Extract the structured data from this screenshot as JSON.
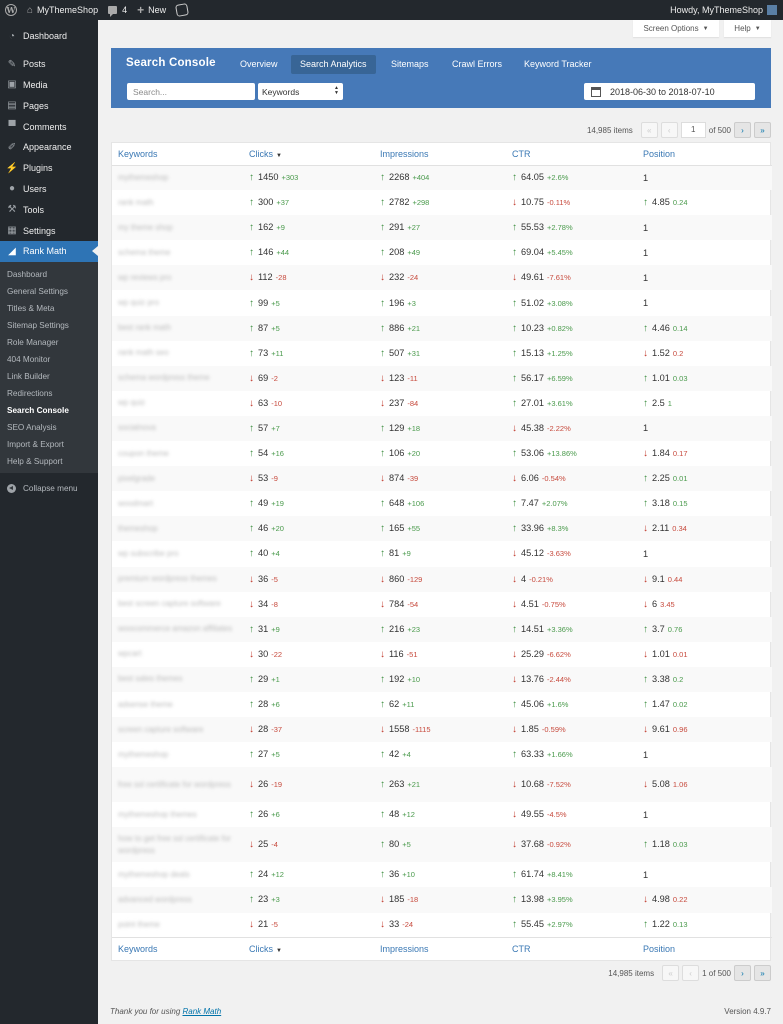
{
  "adminbar": {
    "site_name": "MyThemeShop",
    "comments_count": "4",
    "new_label": "New",
    "howdy": "Howdy, MyThemeShop"
  },
  "sidebar": {
    "items": [
      {
        "label": "Dashboard",
        "icon": "dashboard-icon"
      },
      {
        "label": "Posts",
        "icon": "pin-icon"
      },
      {
        "label": "Media",
        "icon": "media-icon"
      },
      {
        "label": "Pages",
        "icon": "pages-icon"
      },
      {
        "label": "Comments",
        "icon": "comment-icon"
      },
      {
        "label": "Appearance",
        "icon": "brush-icon"
      },
      {
        "label": "Plugins",
        "icon": "plugin-icon"
      },
      {
        "label": "Users",
        "icon": "user-icon"
      },
      {
        "label": "Tools",
        "icon": "wrench-icon"
      },
      {
        "label": "Settings",
        "icon": "settings-icon"
      },
      {
        "label": "Rank Math",
        "icon": "chart-icon"
      }
    ],
    "submenu": [
      "Dashboard",
      "General Settings",
      "Titles & Meta",
      "Sitemap Settings",
      "Role Manager",
      "404 Monitor",
      "Link Builder",
      "Redirections",
      "Search Console",
      "SEO Analysis",
      "Import & Export",
      "Help & Support"
    ],
    "current_submenu": "Search Console",
    "collapse_label": "Collapse menu"
  },
  "screen_meta": {
    "screen_options": "Screen Options",
    "help": "Help"
  },
  "header": {
    "title": "Search Console",
    "tabs": [
      "Overview",
      "Search Analytics",
      "Sitemaps",
      "Crawl Errors",
      "Keyword Tracker"
    ],
    "active_tab": "Search Analytics",
    "search_placeholder": "Search...",
    "dimension_select": "Keywords",
    "date_range": "2018-06-30 to 2018-07-10"
  },
  "pagination": {
    "items": "14,985 items",
    "current_page": "1",
    "of_pages": "of 500",
    "bottom_label": "1 of 500",
    "first": "«",
    "prev": "‹",
    "next": "›",
    "last": "»"
  },
  "table": {
    "columns": [
      "Keywords",
      "Clicks",
      "Impressions",
      "CTR",
      "Position"
    ],
    "sorted_column": "Clicks",
    "rows": [
      {
        "kw": "mythemeshop",
        "clicks": [
          "up",
          "1450",
          "+303"
        ],
        "impr": [
          "up",
          "2268",
          "+404"
        ],
        "ctr": [
          "up",
          "64.05",
          "+2.6%"
        ],
        "pos": [
          "none",
          "1",
          ""
        ]
      },
      {
        "kw": "rank math",
        "clicks": [
          "up",
          "300",
          "+37"
        ],
        "impr": [
          "up",
          "2782",
          "+298"
        ],
        "ctr": [
          "down",
          "10.75",
          "-0.11%"
        ],
        "pos": [
          "up",
          "4.85",
          "0.24"
        ]
      },
      {
        "kw": "my theme shop",
        "clicks": [
          "up",
          "162",
          "+9"
        ],
        "impr": [
          "up",
          "291",
          "+27"
        ],
        "ctr": [
          "up",
          "55.53",
          "+2.78%"
        ],
        "pos": [
          "none",
          "1",
          ""
        ]
      },
      {
        "kw": "schema theme",
        "clicks": [
          "up",
          "146",
          "+44"
        ],
        "impr": [
          "up",
          "208",
          "+49"
        ],
        "ctr": [
          "up",
          "69.04",
          "+5.45%"
        ],
        "pos": [
          "none",
          "1",
          ""
        ]
      },
      {
        "kw": "wp reviews pro",
        "clicks": [
          "down",
          "112",
          "-28"
        ],
        "impr": [
          "down",
          "232",
          "-24"
        ],
        "ctr": [
          "down",
          "49.61",
          "-7.61%"
        ],
        "pos": [
          "none",
          "1",
          ""
        ]
      },
      {
        "kw": "wp quiz pro",
        "clicks": [
          "up",
          "99",
          "+5"
        ],
        "impr": [
          "up",
          "196",
          "+3"
        ],
        "ctr": [
          "up",
          "51.02",
          "+3.08%"
        ],
        "pos": [
          "none",
          "1",
          ""
        ]
      },
      {
        "kw": "best rank math",
        "clicks": [
          "up",
          "87",
          "+5"
        ],
        "impr": [
          "up",
          "886",
          "+21"
        ],
        "ctr": [
          "up",
          "10.23",
          "+0.82%"
        ],
        "pos": [
          "up",
          "4.46",
          "0.14"
        ]
      },
      {
        "kw": "rank math seo",
        "clicks": [
          "up",
          "73",
          "+11"
        ],
        "impr": [
          "up",
          "507",
          "+31"
        ],
        "ctr": [
          "up",
          "15.13",
          "+1.25%"
        ],
        "pos": [
          "down",
          "1.52",
          "0.2"
        ]
      },
      {
        "kw": "schema wordpress theme",
        "clicks": [
          "down",
          "69",
          "-2"
        ],
        "impr": [
          "down",
          "123",
          "-11"
        ],
        "ctr": [
          "up",
          "56.17",
          "+6.59%"
        ],
        "pos": [
          "up",
          "1.01",
          "0.03"
        ]
      },
      {
        "kw": "wp quiz",
        "clicks": [
          "down",
          "63",
          "-10"
        ],
        "impr": [
          "down",
          "237",
          "-84"
        ],
        "ctr": [
          "up",
          "27.01",
          "+3.61%"
        ],
        "pos": [
          "up",
          "2.5",
          "1"
        ]
      },
      {
        "kw": "socialnova",
        "clicks": [
          "up",
          "57",
          "+7"
        ],
        "impr": [
          "up",
          "129",
          "+18"
        ],
        "ctr": [
          "down",
          "45.38",
          "-2.22%"
        ],
        "pos": [
          "none",
          "1",
          ""
        ]
      },
      {
        "kw": "coupon theme",
        "clicks": [
          "up",
          "54",
          "+16"
        ],
        "impr": [
          "up",
          "106",
          "+20"
        ],
        "ctr": [
          "up",
          "53.06",
          "+13.86%"
        ],
        "pos": [
          "down",
          "1.84",
          "0.17"
        ]
      },
      {
        "kw": "pixelgrade",
        "clicks": [
          "down",
          "53",
          "-9"
        ],
        "impr": [
          "down",
          "874",
          "-39"
        ],
        "ctr": [
          "down",
          "6.06",
          "-0.54%"
        ],
        "pos": [
          "up",
          "2.25",
          "0.01"
        ]
      },
      {
        "kw": "woodmart",
        "clicks": [
          "up",
          "49",
          "+19"
        ],
        "impr": [
          "up",
          "648",
          "+106"
        ],
        "ctr": [
          "up",
          "7.47",
          "+2.07%"
        ],
        "pos": [
          "up",
          "3.18",
          "0.15"
        ]
      },
      {
        "kw": "themeshop",
        "clicks": [
          "up",
          "46",
          "+20"
        ],
        "impr": [
          "up",
          "165",
          "+55"
        ],
        "ctr": [
          "up",
          "33.96",
          "+8.3%"
        ],
        "pos": [
          "down",
          "2.11",
          "0.34"
        ]
      },
      {
        "kw": "wp subscribe pro",
        "clicks": [
          "up",
          "40",
          "+4"
        ],
        "impr": [
          "up",
          "81",
          "+9"
        ],
        "ctr": [
          "down",
          "45.12",
          "-3.63%"
        ],
        "pos": [
          "none",
          "1",
          ""
        ]
      },
      {
        "kw": "premium wordpress themes",
        "clicks": [
          "down",
          "36",
          "-5"
        ],
        "impr": [
          "down",
          "860",
          "-129"
        ],
        "ctr": [
          "down",
          "4",
          "-0.21%"
        ],
        "pos": [
          "down",
          "9.1",
          "0.44"
        ]
      },
      {
        "kw": "best screen capture software",
        "clicks": [
          "down",
          "34",
          "-8"
        ],
        "impr": [
          "down",
          "784",
          "-54"
        ],
        "ctr": [
          "down",
          "4.51",
          "-0.75%"
        ],
        "pos": [
          "down",
          "6",
          "3.45"
        ]
      },
      {
        "kw": "woocommerce amazon affiliates",
        "clicks": [
          "up",
          "31",
          "+9"
        ],
        "impr": [
          "up",
          "216",
          "+23"
        ],
        "ctr": [
          "up",
          "14.51",
          "+3.36%"
        ],
        "pos": [
          "up",
          "3.7",
          "0.76"
        ]
      },
      {
        "kw": "wpcart",
        "clicks": [
          "down",
          "30",
          "-22"
        ],
        "impr": [
          "down",
          "116",
          "-51"
        ],
        "ctr": [
          "down",
          "25.29",
          "-6.62%"
        ],
        "pos": [
          "down",
          "1.01",
          "0.01"
        ]
      },
      {
        "kw": "best sales themes",
        "clicks": [
          "up",
          "29",
          "+1"
        ],
        "impr": [
          "up",
          "192",
          "+10"
        ],
        "ctr": [
          "down",
          "13.76",
          "-2.44%"
        ],
        "pos": [
          "up",
          "3.38",
          "0.2"
        ]
      },
      {
        "kw": "adsense theme",
        "clicks": [
          "up",
          "28",
          "+6"
        ],
        "impr": [
          "up",
          "62",
          "+11"
        ],
        "ctr": [
          "up",
          "45.06",
          "+1.6%"
        ],
        "pos": [
          "up",
          "1.47",
          "0.02"
        ]
      },
      {
        "kw": "screen capture software",
        "clicks": [
          "down",
          "28",
          "-37"
        ],
        "impr": [
          "down",
          "1558",
          "-1115"
        ],
        "ctr": [
          "down",
          "1.85",
          "-0.59%"
        ],
        "pos": [
          "down",
          "9.61",
          "0.96"
        ]
      },
      {
        "kw": "mythemeshop",
        "clicks": [
          "up",
          "27",
          "+5"
        ],
        "impr": [
          "up",
          "42",
          "+4"
        ],
        "ctr": [
          "up",
          "63.33",
          "+1.66%"
        ],
        "pos": [
          "none",
          "1",
          ""
        ]
      },
      {
        "kw": "free ssl certificate for wordpress",
        "tall": true,
        "clicks": [
          "down",
          "26",
          "-19"
        ],
        "impr": [
          "up",
          "263",
          "+21"
        ],
        "ctr": [
          "down",
          "10.68",
          "-7.52%"
        ],
        "pos": [
          "down",
          "5.08",
          "1.06"
        ]
      },
      {
        "kw": "mythemeshop themes",
        "clicks": [
          "up",
          "26",
          "+6"
        ],
        "impr": [
          "up",
          "48",
          "+12"
        ],
        "ctr": [
          "down",
          "49.55",
          "-4.5%"
        ],
        "pos": [
          "none",
          "1",
          ""
        ]
      },
      {
        "kw": "how to get free ssl certificate for wordpress",
        "tall": true,
        "clicks": [
          "down",
          "25",
          "-4"
        ],
        "impr": [
          "up",
          "80",
          "+5"
        ],
        "ctr": [
          "down",
          "37.68",
          "-0.92%"
        ],
        "pos": [
          "up",
          "1.18",
          "0.03"
        ]
      },
      {
        "kw": "mythemeshop deals",
        "clicks": [
          "up",
          "24",
          "+12"
        ],
        "impr": [
          "up",
          "36",
          "+10"
        ],
        "ctr": [
          "up",
          "61.74",
          "+8.41%"
        ],
        "pos": [
          "none",
          "1",
          ""
        ]
      },
      {
        "kw": "advanced wordpress",
        "clicks": [
          "up",
          "23",
          "+3"
        ],
        "impr": [
          "down",
          "185",
          "-18"
        ],
        "ctr": [
          "up",
          "13.98",
          "+3.95%"
        ],
        "pos": [
          "down",
          "4.98",
          "0.22"
        ]
      },
      {
        "kw": "point theme",
        "clicks": [
          "down",
          "21",
          "-5"
        ],
        "impr": [
          "down",
          "33",
          "-24"
        ],
        "ctr": [
          "up",
          "55.45",
          "+2.97%"
        ],
        "pos": [
          "up",
          "1.22",
          "0.13"
        ]
      }
    ]
  },
  "footer": {
    "thanks_prefix": "Thank you for using ",
    "thanks_link": "Rank Math",
    "version": "Version 4.9.7"
  },
  "colors": {
    "accent": "#4679b8",
    "up": "#3e8e41",
    "down": "#c0392b",
    "sidebar_bg": "#23282d"
  }
}
